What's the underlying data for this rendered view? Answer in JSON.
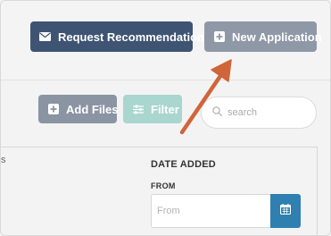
{
  "header": {
    "request_label": "Request Recommendation",
    "new_application_label": "New Application"
  },
  "toolbar": {
    "add_files_label": "Add Files",
    "filter_label": "Filter",
    "search_placeholder": "search"
  },
  "panel": {
    "edge_text": "s",
    "date_added_label": "DATE ADDED",
    "from_label": "FROM",
    "from_placeholder": "From"
  },
  "colors": {
    "request_button": "#3e5472",
    "new_application_button": "#8e98a6",
    "add_files_button": "#8a94a2",
    "filter_button": "#a9d6cf",
    "calendar_button": "#2f7fb0",
    "annotation_arrow": "#d0643a"
  },
  "icons": {
    "request": "envelope-icon",
    "new_application": "plus-square-icon",
    "add_files": "plus-square-icon",
    "filter": "sliders-icon",
    "search": "search-icon",
    "calendar": "calendar-icon"
  }
}
